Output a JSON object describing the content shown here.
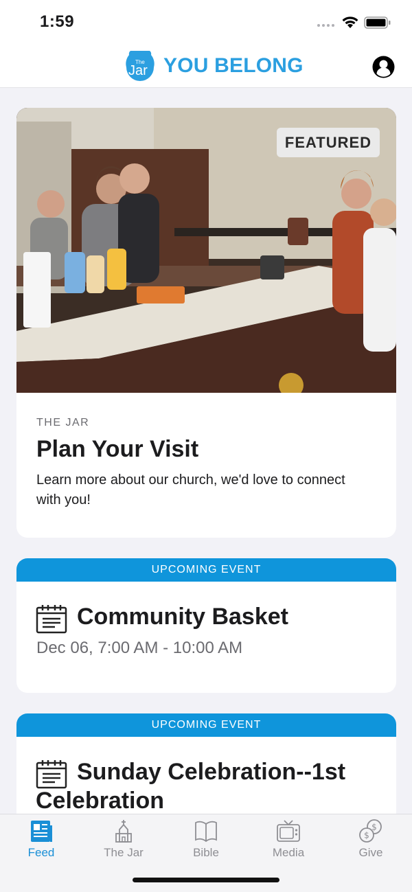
{
  "status_bar": {
    "time": "1:59"
  },
  "header": {
    "logo_small": "The",
    "logo_word": "Jar",
    "title": "YOU BELONG"
  },
  "featured": {
    "badge": "FEATURED",
    "kicker": "THE JAR",
    "title": "Plan Your Visit",
    "description": "Learn more about our church, we'd love to connect with you!"
  },
  "events": [
    {
      "banner": "UPCOMING EVENT",
      "title": "Community Basket",
      "time": "Dec 06, 7:00 AM - 10:00 AM"
    },
    {
      "banner": "UPCOMING EVENT",
      "title_line1": "Sunday Celebration--1st",
      "title_line2": "Celebration"
    }
  ],
  "tabs": [
    {
      "label": "Feed",
      "icon": "newspaper-icon",
      "active": true
    },
    {
      "label": "The Jar",
      "icon": "church-icon",
      "active": false
    },
    {
      "label": "Bible",
      "icon": "book-icon",
      "active": false
    },
    {
      "label": "Media",
      "icon": "tv-icon",
      "active": false
    },
    {
      "label": "Give",
      "icon": "coins-icon",
      "active": false
    }
  ],
  "colors": {
    "accent": "#0f95db",
    "brand": "#2b9fe0",
    "tab_active": "#1a8fd6"
  }
}
